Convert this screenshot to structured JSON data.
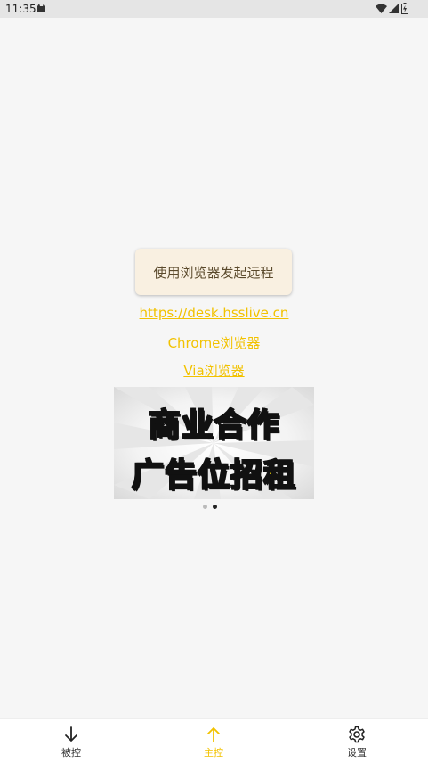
{
  "status_bar": {
    "time": "11:35",
    "icons": [
      "notification-icon",
      "wifi-icon",
      "signal-icon",
      "battery-icon"
    ]
  },
  "main": {
    "remote_button_label": "使用浏览器发起远程",
    "links": {
      "url": "https://desk.hsslive.cn",
      "chrome": "Chrome浏览器",
      "via": "Via浏览器"
    },
    "banner": {
      "line1": "商业合作",
      "line2": "广告位招租"
    },
    "carousel": {
      "count": 2,
      "active_index": 1
    }
  },
  "bottom_nav": {
    "items": [
      {
        "label": "被控",
        "icon": "arrow-down-icon",
        "active": false
      },
      {
        "label": "主控",
        "icon": "arrow-up-icon",
        "active": true
      },
      {
        "label": "设置",
        "icon": "gear-icon",
        "active": false
      }
    ]
  },
  "colors": {
    "accent": "#f2c200",
    "background": "#f6f6f6",
    "button_bg": "#f9f0e1",
    "button_text": "#5b4a2c",
    "banner_text": "#ffe500"
  }
}
